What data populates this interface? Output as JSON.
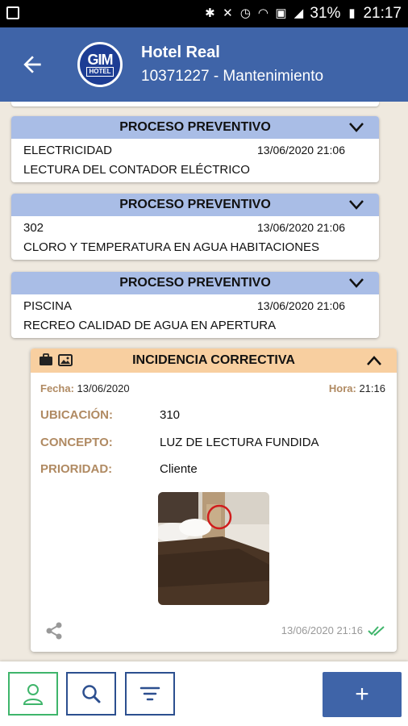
{
  "status": {
    "battery": "31%",
    "time": "21:17"
  },
  "header": {
    "logo_text_top": "GIM",
    "logo_text_bottom": "HOTEL",
    "title": "Hotel Real",
    "subtitle": "10371227 - Mantenimiento"
  },
  "cards": [
    {
      "header": "PROCESO PREVENTIVO",
      "category": "ELECTRICIDAD",
      "datetime": "13/06/2020 21:06",
      "description": "LECTURA DEL CONTADOR ELÉCTRICO"
    },
    {
      "header": "PROCESO PREVENTIVO",
      "category": "302",
      "datetime": "13/06/2020 21:06",
      "description": "CLORO Y TEMPERATURA EN AGUA HABITACIONES"
    },
    {
      "header": "PROCESO PREVENTIVO",
      "category": "PISCINA",
      "datetime": "13/06/2020 21:06",
      "description": "RECREO CALIDAD DE AGUA EN APERTURA"
    }
  ],
  "incident": {
    "header": "INCIDENCIA CORRECTIVA",
    "fecha_label": "Fecha:",
    "fecha_value": "13/06/2020",
    "hora_label": "Hora:",
    "hora_value": "21:16",
    "ubicacion_label": "UBICACIÓN:",
    "ubicacion_value": "310",
    "concepto_label": "CONCEPTO:",
    "concepto_value": "LUZ DE LECTURA FUNDIDA",
    "prioridad_label": "PRIORIDAD:",
    "prioridad_value": "Cliente",
    "footer_datetime": "13/06/2020 21:16"
  },
  "bottom": {
    "add_label": "+"
  },
  "colors": {
    "appbar": "#3f64a8",
    "preventive_header": "#a9bde6",
    "corrective_header": "#f8cfa0",
    "label_brown": "#b08a62",
    "active_green": "#3fb56b"
  }
}
